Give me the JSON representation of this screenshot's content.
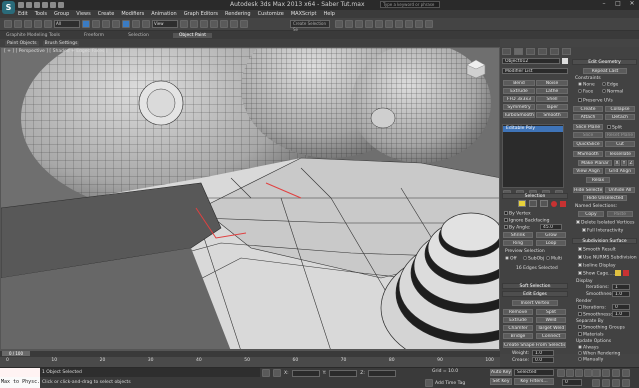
{
  "window": {
    "title": "Autodesk 3ds Max 2013 x64 - Saber Tut.max",
    "search_placeholder": "Type a keyword or phrase",
    "logo_glyph": "S"
  },
  "menu": [
    "Edit",
    "Tools",
    "Group",
    "Views",
    "Create",
    "Modifiers",
    "Animation",
    "Graph Editors",
    "Rendering",
    "Customize",
    "MAXScript",
    "Help"
  ],
  "toolbar": {
    "filter_value": "All",
    "refcoord_value": "View",
    "selection_set_placeholder": "Create Selection Se"
  },
  "ribbon": {
    "tabs": [
      {
        "label": "Graphite Modeling Tools",
        "active": false
      },
      {
        "label": "Freeform",
        "active": false
      },
      {
        "label": "Selection",
        "active": false
      },
      {
        "label": "Object Paint",
        "active": true
      }
    ],
    "subtabs": [
      "Paint Objects",
      "Brush Settings"
    ]
  },
  "viewport": {
    "label": "[ + ] [ Perspective ] [ Shaded + Edged Faces ]"
  },
  "command_panel": {
    "object_name": "Object012",
    "modifier_list": "Modifier List",
    "modifier_buttons": [
      "Bend",
      "Noise",
      "Extrude",
      "Lathe",
      "FFD 3x3x3",
      "Shell",
      "Symmetry",
      "Taper",
      "TurboSmooth",
      "Smooth"
    ],
    "stack_item": "Editable Poly",
    "selection": {
      "title": "Selection",
      "by_vertex": "By Vertex",
      "ignore_backfacing": "Ignore Backfacing",
      "by_angle": "By Angle:",
      "by_angle_value": "45.0",
      "shrink": "Shrink",
      "grow": "Grow",
      "ring": "Ring",
      "loop": "Loop",
      "preview_selection": "Preview Selection",
      "preview_off": "Off",
      "preview_subobj": "SubObj",
      "preview_multi": "Multi",
      "status": "16 Edges Selected"
    },
    "soft_selection": "Soft Selection",
    "edit_edges": {
      "title": "Edit Edges",
      "insert_vertex": "Insert Vertex",
      "remove": "Remove",
      "split": "Split",
      "extrude": "Extrude",
      "weld": "Weld",
      "chamfer": "Chamfer",
      "target_weld": "Target Weld",
      "bridge": "Bridge",
      "connect": "Connect",
      "create_shape": "Create Shape From Selection",
      "weight_label": "Weight:",
      "weight_value": "1.0",
      "crease_label": "Crease:",
      "crease_value": "0.0"
    },
    "edit_geometry": {
      "title": "Edit Geometry",
      "repeat_last": "Repeat Last",
      "constraints": "Constraints",
      "none": "None",
      "edge": "Edge",
      "face": "Face",
      "normal": "Normal",
      "preserve_uvs": "Preserve UVs",
      "create": "Create",
      "collapse": "Collapse",
      "attach": "Attach",
      "detach": "Detach",
      "slice_plane": "Slice Plane",
      "split": "Split",
      "slice": "Slice",
      "reset_plane": "Reset Plane",
      "quickslice": "QuickSlice",
      "cut": "Cut",
      "msmooth": "MSmooth",
      "tessellate": "Tessellate",
      "make_planar": "Make Planar",
      "x": "X",
      "y": "Y",
      "z": "Z",
      "view_align": "View Align",
      "grid_align": "Grid Align",
      "relax": "Relax",
      "hide_selected": "Hide Selected",
      "unhide_all": "Unhide All",
      "hide_unselected": "Hide Unselected",
      "named_selections": "Named Selections:",
      "copy": "Copy",
      "paste": "Paste",
      "delete_isolated": "Delete Isolated Vertices",
      "full_interactivity": "Full Interactivity"
    },
    "subdivision_surface": {
      "title": "Subdivision Surface",
      "smooth_result": "Smooth Result",
      "use_nurms": "Use NURMS Subdivision",
      "isoline_display": "Isoline Display",
      "show_cage": "Show Cage......",
      "display": "Display",
      "iterations_label": "Iterations:",
      "iterations_value": "1",
      "smoothness_label": "Smoothness:",
      "smoothness_value": "1.0",
      "render": "Render",
      "render_iterations_value": "0",
      "render_smoothness_value": "1.0",
      "separate_by": "Separate By",
      "smoothing_groups": "Smoothing Groups",
      "materials": "Materials",
      "update_options": "Update Options",
      "always": "Always",
      "when_rendering": "When Rendering",
      "manually": "Manually"
    }
  },
  "timeline": {
    "thumb": "0 / 100",
    "ticks": [
      "0",
      "10",
      "20",
      "30",
      "40",
      "50",
      "60",
      "70",
      "80",
      "90",
      "100"
    ]
  },
  "status": {
    "maxscript_text": "Max to Physc.",
    "selected": "1 Object Selected",
    "prompt": "Click or click-and-drag to select objects",
    "x_label": "X:",
    "y_label": "Y:",
    "z_label": "Z:",
    "grid": "Grid = 10.0",
    "add_time_tag": "Add Time Tag",
    "auto_key": "Auto Key",
    "selected_dropdown": "Selected",
    "set_key": "Set Key",
    "key_filters": "Key Filters...",
    "frame_value": "0"
  },
  "colors": {
    "viewport_bg": "#6b6b6b",
    "accent_blue": "#3f74b8",
    "selected_edge": "#e04040",
    "autokey_red": "#c83232"
  }
}
